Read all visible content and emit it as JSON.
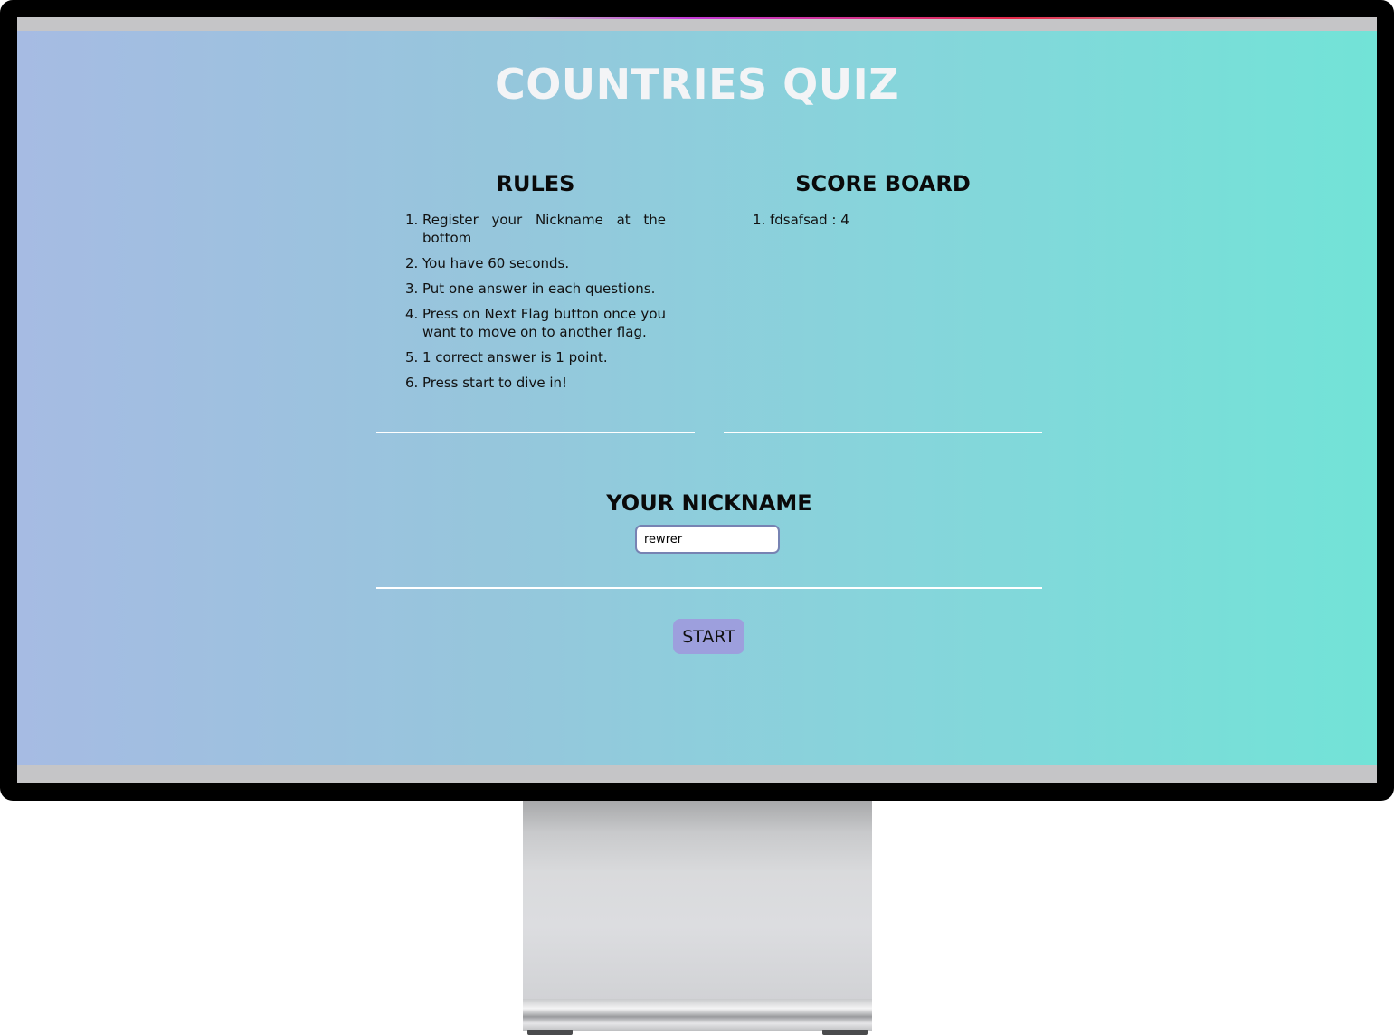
{
  "app": {
    "title": "COUNTRIES QUIZ"
  },
  "rules": {
    "heading": "RULES",
    "items": [
      {
        "num": "1.",
        "text": "Register your Nickname at the bottom"
      },
      {
        "num": "2.",
        "text": "You have 60 seconds."
      },
      {
        "num": "3.",
        "text": "Put one answer in each questions."
      },
      {
        "num": "4.",
        "text": "Press on Next Flag button once you want to move on to another flag."
      },
      {
        "num": "5.",
        "text": "1 correct answer is 1 point."
      },
      {
        "num": "6.",
        "text": "Press start to dive in!"
      }
    ]
  },
  "scoreboard": {
    "heading": "SCORE BOARD",
    "entries": [
      {
        "num": "1.",
        "text": "fdsafsad : 4"
      }
    ]
  },
  "nickname": {
    "heading": "YOUR NICKNAME",
    "value": "rewrer"
  },
  "actions": {
    "start_label": "START"
  },
  "colors": {
    "gradient_start": "#a6bbe3",
    "gradient_end": "#72e3d7",
    "button_bg": "#9d9fdd",
    "title_color": "#f3f4f6"
  }
}
